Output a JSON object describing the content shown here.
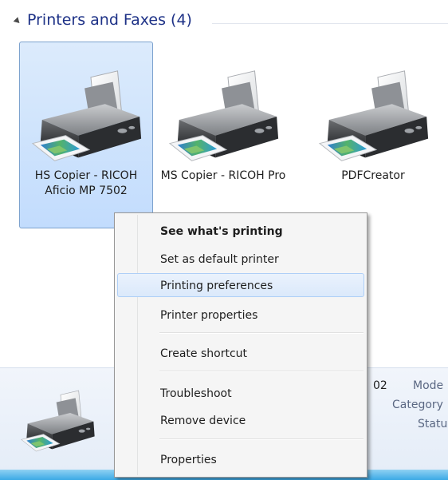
{
  "group": {
    "title": "Printers and Faxes (4)"
  },
  "printers": [
    {
      "label": "HS Copier - RICOH Aficio MP 7502",
      "selected": true
    },
    {
      "label": "MS Copier - RICOH Pro",
      "selected": false
    },
    {
      "label": "PDFCreator",
      "selected": false
    }
  ],
  "details": {
    "fragment_value": "02",
    "model_label": "Mode",
    "category_label": "Category",
    "status_label": "Statu"
  },
  "context_menu": {
    "items": [
      {
        "label": "See what's printing",
        "bold": true
      },
      {
        "label": "Set as default printer"
      },
      {
        "label": "Printing preferences",
        "hover": true
      },
      {
        "label": "Printer properties"
      },
      {
        "label": "Create shortcut"
      },
      {
        "label": "Troubleshoot"
      },
      {
        "label": "Remove device"
      },
      {
        "label": "Properties"
      }
    ]
  },
  "colors": {
    "group_title": "#1e3287",
    "selection": "#c2dcfd",
    "menu_hover": "#dbe9fb",
    "taskbar": "#3ba9e6"
  },
  "icons": [
    "collapse-arrow-icon",
    "printer-icon"
  ]
}
